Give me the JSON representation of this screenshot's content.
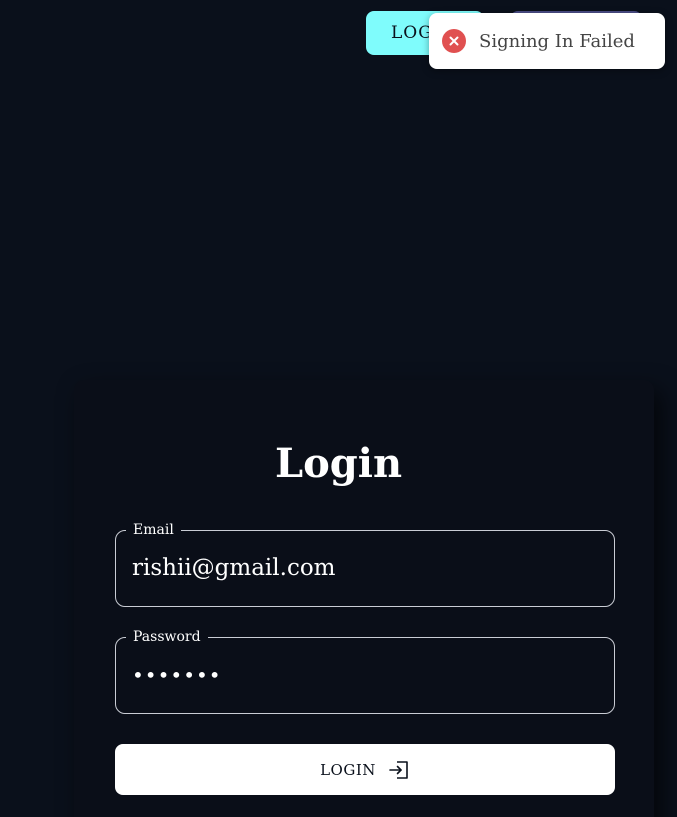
{
  "nav": {
    "login_label": "LOGIN",
    "colors": {
      "login_bg": "#7ffcfc",
      "second_bg": "#4b4e86"
    }
  },
  "toast": {
    "message": "Signing In Failed",
    "icon": "error-x-icon",
    "color": "#e05050"
  },
  "form": {
    "title": "Login",
    "email": {
      "label": "Email",
      "value": "rishii@gmail.com"
    },
    "password": {
      "label": "Password",
      "value": "•••••••"
    },
    "submit_label": "LOGIN",
    "submit_icon": "login-icon"
  },
  "colors": {
    "background": "#0a101b",
    "text": "#ffffff"
  }
}
